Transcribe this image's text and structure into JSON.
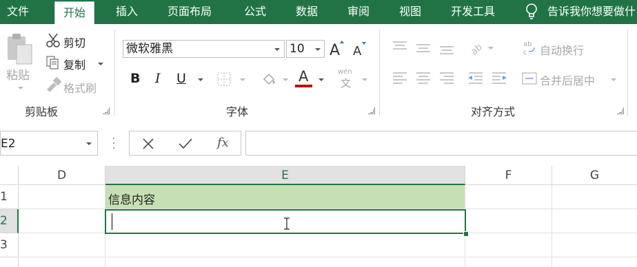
{
  "tabs": [
    "文件",
    "开始",
    "插入",
    "页面布局",
    "公式",
    "数据",
    "审阅",
    "视图",
    "开发工具"
  ],
  "tell_me": "告诉我你想要做什",
  "clipboard": {
    "paste": "粘贴",
    "cut": "剪切",
    "copy": "复制",
    "format_painter": "格式刷",
    "label": "剪贴板"
  },
  "font": {
    "name": "微软雅黑",
    "size": "10",
    "bold": "B",
    "italic": "I",
    "underline": "U",
    "font_color_glyph": "A",
    "phonetic_top": "wén",
    "phonetic_bottom": "文",
    "label": "字体"
  },
  "alignment": {
    "wrap_text": "自动换行",
    "merge_center": "合并后居中",
    "label": "对齐方式"
  },
  "formula_bar": {
    "name_box": "E2",
    "fx": "fx",
    "formula": ""
  },
  "columns": [
    "D",
    "E",
    "F",
    "G"
  ],
  "rows": [
    "1",
    "2",
    "3"
  ],
  "cells": {
    "E1": "信息内容",
    "E2": ""
  },
  "colors": {
    "accent": "#217346",
    "header_fill": "#c6e0b4",
    "font_color_bar": "#c00000"
  }
}
